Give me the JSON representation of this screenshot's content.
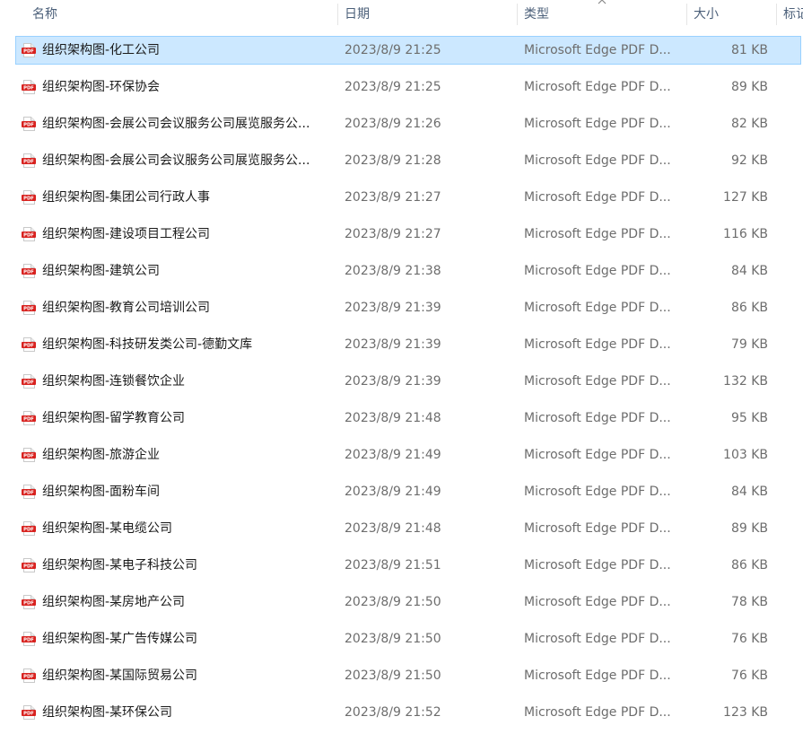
{
  "columns": {
    "name": "名称",
    "date": "日期",
    "type": "类型",
    "size": "大小",
    "tags": "标记"
  },
  "sort_icon": "chevron-up-icon",
  "file_icon": "pdf-file-icon",
  "colors": {
    "selection_bg": "#cce8ff",
    "selection_border": "#99d1ff",
    "pdf_red": "#d8221f"
  },
  "files": [
    {
      "name": "组织架构图-化工公司",
      "date": "2023/8/9 21:25",
      "type": "Microsoft Edge PDF D...",
      "size": "81 KB",
      "selected": true
    },
    {
      "name": "组织架构图-环保协会",
      "date": "2023/8/9 21:25",
      "type": "Microsoft Edge PDF D...",
      "size": "89 KB"
    },
    {
      "name": "组织架构图-会展公司会议服务公司展览服务公...",
      "date": "2023/8/9 21:26",
      "type": "Microsoft Edge PDF D...",
      "size": "82 KB"
    },
    {
      "name": "组织架构图-会展公司会议服务公司展览服务公...",
      "date": "2023/8/9 21:28",
      "type": "Microsoft Edge PDF D...",
      "size": "92 KB"
    },
    {
      "name": "组织架构图-集团公司行政人事",
      "date": "2023/8/9 21:27",
      "type": "Microsoft Edge PDF D...",
      "size": "127 KB"
    },
    {
      "name": "组织架构图-建设项目工程公司",
      "date": "2023/8/9 21:27",
      "type": "Microsoft Edge PDF D...",
      "size": "116 KB"
    },
    {
      "name": "组织架构图-建筑公司",
      "date": "2023/8/9 21:38",
      "type": "Microsoft Edge PDF D...",
      "size": "84 KB"
    },
    {
      "name": "组织架构图-教育公司培训公司",
      "date": "2023/8/9 21:39",
      "type": "Microsoft Edge PDF D...",
      "size": "86 KB"
    },
    {
      "name": "组织架构图-科技研发类公司-德勤文库",
      "date": "2023/8/9 21:39",
      "type": "Microsoft Edge PDF D...",
      "size": "79 KB"
    },
    {
      "name": "组织架构图-连锁餐饮企业",
      "date": "2023/8/9 21:39",
      "type": "Microsoft Edge PDF D...",
      "size": "132 KB"
    },
    {
      "name": "组织架构图-留学教育公司",
      "date": "2023/8/9 21:48",
      "type": "Microsoft Edge PDF D...",
      "size": "95 KB"
    },
    {
      "name": "组织架构图-旅游企业",
      "date": "2023/8/9 21:49",
      "type": "Microsoft Edge PDF D...",
      "size": "103 KB"
    },
    {
      "name": "组织架构图-面粉车间",
      "date": "2023/8/9 21:49",
      "type": "Microsoft Edge PDF D...",
      "size": "84 KB"
    },
    {
      "name": "组织架构图-某电缆公司",
      "date": "2023/8/9 21:48",
      "type": "Microsoft Edge PDF D...",
      "size": "89 KB"
    },
    {
      "name": "组织架构图-某电子科技公司",
      "date": "2023/8/9 21:51",
      "type": "Microsoft Edge PDF D...",
      "size": "86 KB"
    },
    {
      "name": "组织架构图-某房地产公司",
      "date": "2023/8/9 21:50",
      "type": "Microsoft Edge PDF D...",
      "size": "78 KB"
    },
    {
      "name": "组织架构图-某广告传媒公司",
      "date": "2023/8/9 21:50",
      "type": "Microsoft Edge PDF D...",
      "size": "76 KB"
    },
    {
      "name": "组织架构图-某国际贸易公司",
      "date": "2023/8/9 21:50",
      "type": "Microsoft Edge PDF D...",
      "size": "76 KB"
    },
    {
      "name": "组织架构图-某环保公司",
      "date": "2023/8/9 21:52",
      "type": "Microsoft Edge PDF D...",
      "size": "123 KB"
    }
  ]
}
